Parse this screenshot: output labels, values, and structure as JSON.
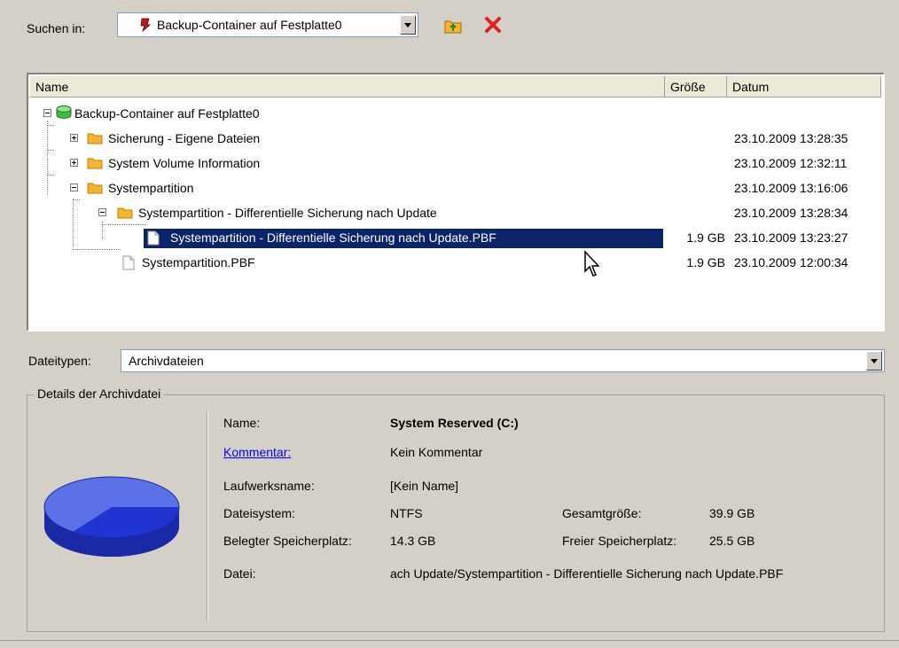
{
  "toolbar": {
    "look_in_label": "Suchen in:",
    "look_in_value": "Backup-Container auf Festplatte0"
  },
  "columns": {
    "name": "Name",
    "size": "Größe",
    "date": "Datum"
  },
  "tree": {
    "root": "Backup-Container auf Festplatte0",
    "rows": [
      {
        "label": "Sicherung - Eigene Dateien",
        "size": "",
        "date": "23.10.2009 13:28:35"
      },
      {
        "label": "System Volume Information",
        "size": "",
        "date": "23.10.2009 12:32:11"
      },
      {
        "label": "Systempartition",
        "size": "",
        "date": "23.10.2009 13:16:06"
      },
      {
        "label": "Systempartition - Differentielle Sicherung nach Update",
        "size": "",
        "date": "23.10.2009 13:28:34"
      },
      {
        "label": "Systempartition - Differentielle Sicherung nach Update.PBF",
        "size": "1.9 GB",
        "date": "23.10.2009 13:23:27"
      },
      {
        "label": "Systempartition.PBF",
        "size": "1.9 GB",
        "date": "23.10.2009 12:00:34"
      }
    ]
  },
  "file_types": {
    "label": "Dateitypen:",
    "value": "Archivdateien"
  },
  "details": {
    "title": "Details der Archivdatei",
    "name_label": "Name:",
    "name_value": "System Reserved (C:)",
    "comment_label": "Kommentar:",
    "comment_value": "Kein Kommentar",
    "drive_label": "Laufwerksname:",
    "drive_value": "[Kein Name]",
    "fs_label": "Dateisystem:",
    "fs_value": "NTFS",
    "total_label": "Gesamtgröße:",
    "total_value": "39.9 GB",
    "used_label": "Belegter Speicherplatz:",
    "used_value": "14.3 GB",
    "free_label": "Freier Speicherplatz:",
    "free_value": "25.5 GB",
    "file_label": "Datei:",
    "file_value": "ach Update/Systempartition - Differentielle Sicherung nach Update.PBF"
  },
  "colors": {
    "selection": "#0a246a",
    "pie_used": "#1e2fc8",
    "pie_free": "#5a72e6",
    "folder": "#f5b531"
  }
}
